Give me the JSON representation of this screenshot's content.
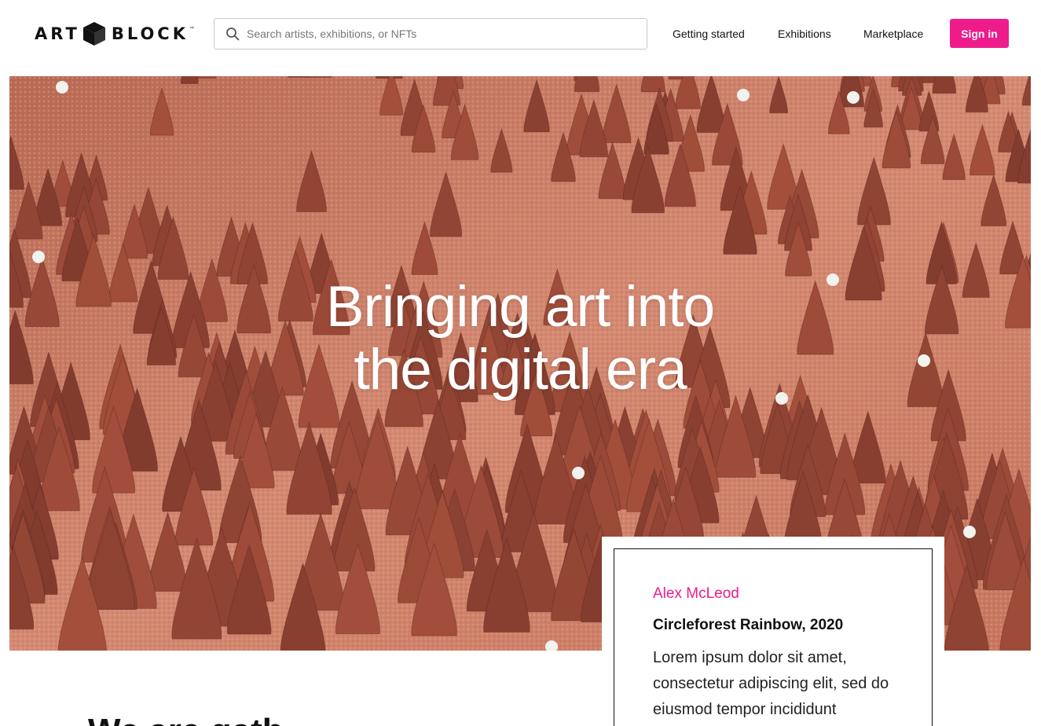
{
  "brand": {
    "name_left": "ART",
    "name_right": "BLOCK",
    "trademark": "™",
    "logo_icon": "cube-icon"
  },
  "search": {
    "placeholder": "Search artists, exhibitions, or NFTs",
    "value": "",
    "icon": "search-icon"
  },
  "nav": {
    "items": [
      {
        "label": "Getting started"
      },
      {
        "label": "Exhibitions"
      },
      {
        "label": "Marketplace"
      }
    ],
    "signin_label": "Sign in"
  },
  "hero": {
    "title": "Bringing art into the digital era"
  },
  "featured": {
    "artist": "Alex McLeod",
    "title": "Circleforest Rainbow, 2020",
    "description": "Lorem ipsum dolor sit amet, consectetur adipiscing elit, sed do eiusmod tempor incididunt"
  },
  "section": {
    "heading": "We are gath"
  },
  "colors": {
    "accent": "#ee1b8b",
    "hero_ground": "#c97a63",
    "hero_trees": "#8a4a3a"
  }
}
